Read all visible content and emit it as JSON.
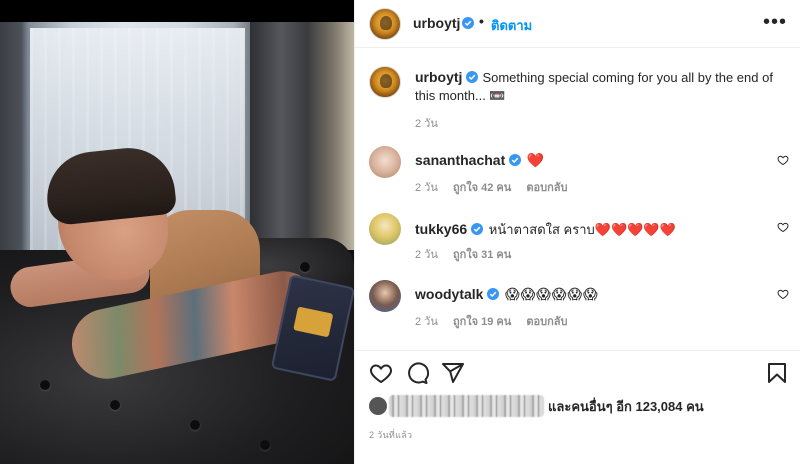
{
  "post": {
    "username": "urboytj",
    "follow_label": "ติดตาม",
    "dot": "•",
    "more": "•••"
  },
  "caption": {
    "username": "urboytj",
    "text": "Something special coming for you all by the end of this month... 📼",
    "time": "2 วัน"
  },
  "comments": [
    {
      "username": "sananthachat",
      "text": "❤️",
      "time": "2 วัน",
      "likes": "ถูกใจ 42 คน",
      "reply": "ตอบกลับ"
    },
    {
      "username": "tukky66",
      "text": "หน้าตาสดใส คราบ❤️❤️❤️❤️❤️",
      "time": "2 วัน",
      "likes": "ถูกใจ 31 คน",
      "reply": ""
    },
    {
      "username": "woodytalk",
      "text": "😱😱😱😱😱😱",
      "time": "2 วัน",
      "likes": "ถูกใจ 19 คน",
      "reply": "ตอบกลับ"
    }
  ],
  "likes_summary": "และคนอื่นๆ อีก 123,084 คน",
  "posted_ago": "2 วันที่แล้ว",
  "icons": [
    "heart-outline-icon",
    "comment-icon",
    "share-icon",
    "bookmark-icon",
    "verified-badge-icon",
    "more-icon"
  ],
  "colors": {
    "accent": "#0095f6",
    "verified": "#3897f0",
    "heart_red": "#e0245e",
    "muted": "#8e8e8e"
  }
}
